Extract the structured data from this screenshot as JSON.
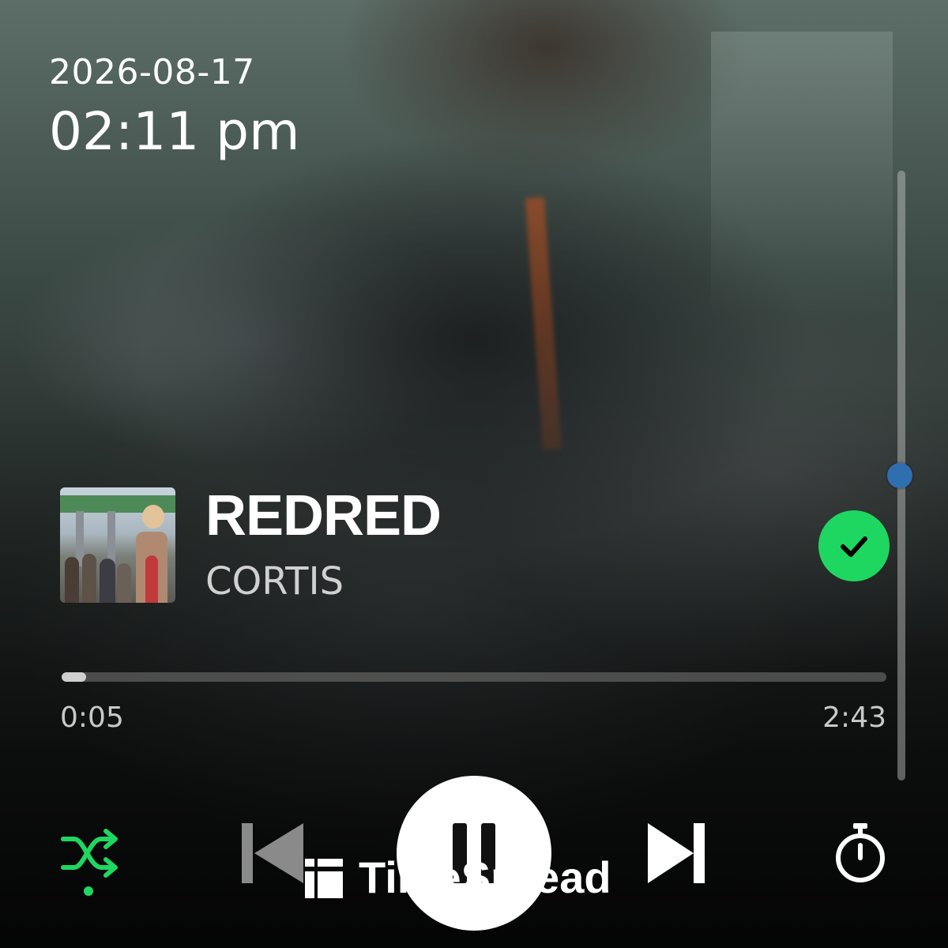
{
  "status": {
    "date": "2026-08-17",
    "time": "02:11 pm"
  },
  "track": {
    "title": "REDRED",
    "artist": "CORTIS",
    "saved": true
  },
  "progress": {
    "elapsed": "0:05",
    "total": "2:43",
    "fraction": 0.03
  },
  "volume": {
    "level": 0.5
  },
  "controls": {
    "shuffle_icon": "shuffle-icon",
    "previous_icon": "skip-previous-icon",
    "play_pause_icon": "pause-icon",
    "next_icon": "skip-next-icon",
    "timer_icon": "sleep-timer-icon"
  },
  "watermark": {
    "text": "TimeSpread"
  },
  "colors": {
    "accent": "#1ed760",
    "volume_thumb": "#2f6fb0"
  }
}
